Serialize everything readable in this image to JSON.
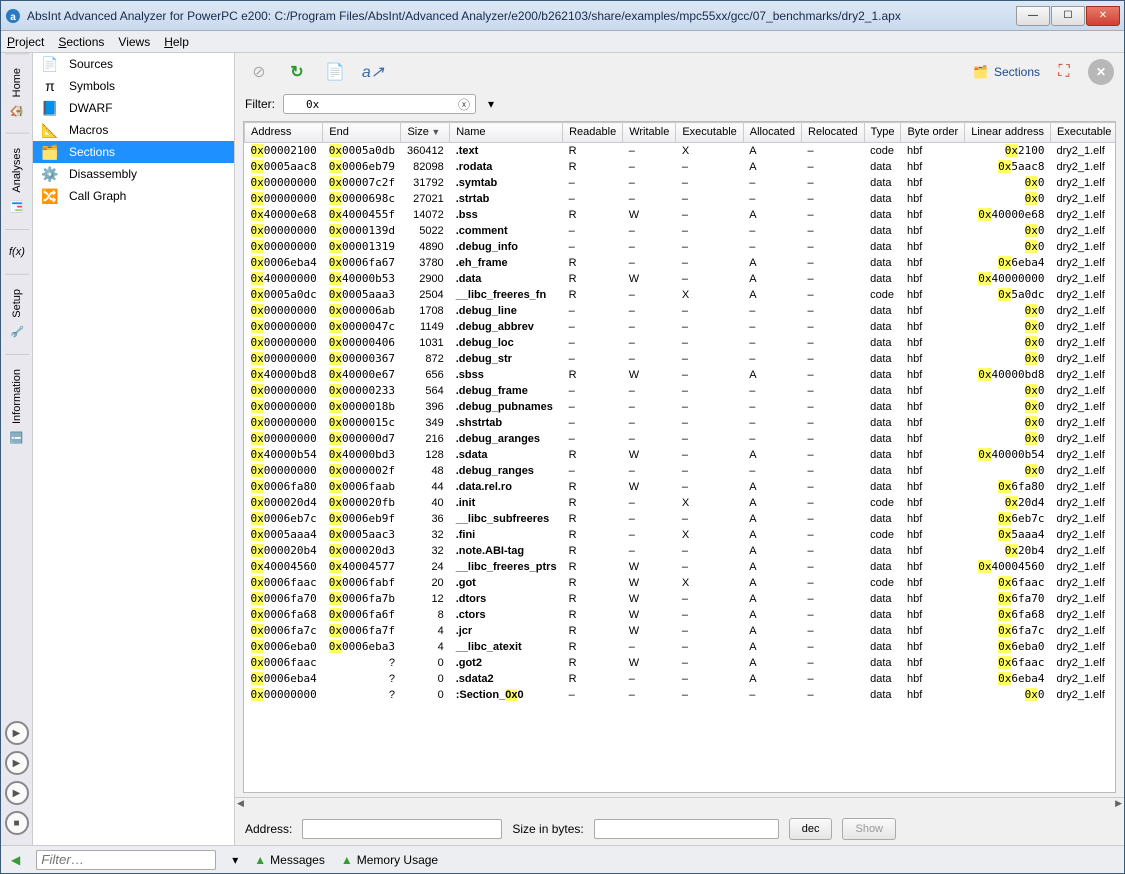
{
  "window": {
    "title": "AbsInt Advanced Analyzer for PowerPC e200: C:/Program Files/AbsInt/Advanced Analyzer/e200/b262103/share/examples/mpc55xx/gcc/07_benchmarks/dry2_1.apx"
  },
  "menu": {
    "project": "Project",
    "sections": "Sections",
    "views": "Views",
    "help": "Help"
  },
  "rail": {
    "home": "Home",
    "analyses": "Analyses",
    "setup": "Setup",
    "information": "Information"
  },
  "sidebar": {
    "items": [
      {
        "label": "Sources"
      },
      {
        "label": "Symbols"
      },
      {
        "label": "DWARF"
      },
      {
        "label": "Macros"
      },
      {
        "label": "Sections"
      },
      {
        "label": "Disassembly"
      },
      {
        "label": "Call Graph"
      }
    ],
    "activeIndex": 4
  },
  "toolbar": {
    "sections_label": "Sections"
  },
  "filter": {
    "label": "Filter:",
    "value": "0x"
  },
  "columns": [
    "Address",
    "End",
    "Size",
    "Name",
    "Readable",
    "Writable",
    "Executable",
    "Allocated",
    "Relocated",
    "Type",
    "Byte order",
    "Linear address",
    "Executable"
  ],
  "sortedColIndex": 2,
  "rows": [
    {
      "addr": "00002100",
      "end": "0005a0db",
      "size": "360412",
      "name": ".text",
      "r": "R",
      "w": "–",
      "x": "X",
      "a": "A",
      "rel": "–",
      "type": "code",
      "bo": "hbf",
      "lin": "2100",
      "exec": "dry2_1.elf"
    },
    {
      "addr": "0005aac8",
      "end": "0006eb79",
      "size": "82098",
      "name": ".rodata",
      "r": "R",
      "w": "–",
      "x": "–",
      "a": "A",
      "rel": "–",
      "type": "data",
      "bo": "hbf",
      "lin": "5aac8",
      "exec": "dry2_1.elf"
    },
    {
      "addr": "00000000",
      "end": "00007c2f",
      "size": "31792",
      "name": ".symtab",
      "r": "–",
      "w": "–",
      "x": "–",
      "a": "–",
      "rel": "–",
      "type": "data",
      "bo": "hbf",
      "lin": "0",
      "exec": "dry2_1.elf"
    },
    {
      "addr": "00000000",
      "end": "0000698c",
      "size": "27021",
      "name": ".strtab",
      "r": "–",
      "w": "–",
      "x": "–",
      "a": "–",
      "rel": "–",
      "type": "data",
      "bo": "hbf",
      "lin": "0",
      "exec": "dry2_1.elf"
    },
    {
      "addr": "40000e68",
      "end": "4000455f",
      "size": "14072",
      "name": ".bss",
      "r": "R",
      "w": "W",
      "x": "–",
      "a": "A",
      "rel": "–",
      "type": "data",
      "bo": "hbf",
      "lin": "40000e68",
      "exec": "dry2_1.elf"
    },
    {
      "addr": "00000000",
      "end": "0000139d",
      "size": "5022",
      "name": ".comment",
      "r": "–",
      "w": "–",
      "x": "–",
      "a": "–",
      "rel": "–",
      "type": "data",
      "bo": "hbf",
      "lin": "0",
      "exec": "dry2_1.elf"
    },
    {
      "addr": "00000000",
      "end": "00001319",
      "size": "4890",
      "name": ".debug_info",
      "r": "–",
      "w": "–",
      "x": "–",
      "a": "–",
      "rel": "–",
      "type": "data",
      "bo": "hbf",
      "lin": "0",
      "exec": "dry2_1.elf"
    },
    {
      "addr": "0006eba4",
      "end": "0006fa67",
      "size": "3780",
      "name": ".eh_frame",
      "r": "R",
      "w": "–",
      "x": "–",
      "a": "A",
      "rel": "–",
      "type": "data",
      "bo": "hbf",
      "lin": "6eba4",
      "exec": "dry2_1.elf"
    },
    {
      "addr": "40000000",
      "end": "40000b53",
      "size": "2900",
      "name": ".data",
      "r": "R",
      "w": "W",
      "x": "–",
      "a": "A",
      "rel": "–",
      "type": "data",
      "bo": "hbf",
      "lin": "40000000",
      "exec": "dry2_1.elf"
    },
    {
      "addr": "0005a0dc",
      "end": "0005aaa3",
      "size": "2504",
      "name": "__libc_freeres_fn",
      "r": "R",
      "w": "–",
      "x": "X",
      "a": "A",
      "rel": "–",
      "type": "code",
      "bo": "hbf",
      "lin": "5a0dc",
      "exec": "dry2_1.elf"
    },
    {
      "addr": "00000000",
      "end": "000006ab",
      "size": "1708",
      "name": ".debug_line",
      "r": "–",
      "w": "–",
      "x": "–",
      "a": "–",
      "rel": "–",
      "type": "data",
      "bo": "hbf",
      "lin": "0",
      "exec": "dry2_1.elf"
    },
    {
      "addr": "00000000",
      "end": "0000047c",
      "size": "1149",
      "name": ".debug_abbrev",
      "r": "–",
      "w": "–",
      "x": "–",
      "a": "–",
      "rel": "–",
      "type": "data",
      "bo": "hbf",
      "lin": "0",
      "exec": "dry2_1.elf"
    },
    {
      "addr": "00000000",
      "end": "00000406",
      "size": "1031",
      "name": ".debug_loc",
      "r": "–",
      "w": "–",
      "x": "–",
      "a": "–",
      "rel": "–",
      "type": "data",
      "bo": "hbf",
      "lin": "0",
      "exec": "dry2_1.elf"
    },
    {
      "addr": "00000000",
      "end": "00000367",
      "size": "872",
      "name": ".debug_str",
      "r": "–",
      "w": "–",
      "x": "–",
      "a": "–",
      "rel": "–",
      "type": "data",
      "bo": "hbf",
      "lin": "0",
      "exec": "dry2_1.elf"
    },
    {
      "addr": "40000bd8",
      "end": "40000e67",
      "size": "656",
      "name": ".sbss",
      "r": "R",
      "w": "W",
      "x": "–",
      "a": "A",
      "rel": "–",
      "type": "data",
      "bo": "hbf",
      "lin": "40000bd8",
      "exec": "dry2_1.elf"
    },
    {
      "addr": "00000000",
      "end": "00000233",
      "size": "564",
      "name": ".debug_frame",
      "r": "–",
      "w": "–",
      "x": "–",
      "a": "–",
      "rel": "–",
      "type": "data",
      "bo": "hbf",
      "lin": "0",
      "exec": "dry2_1.elf"
    },
    {
      "addr": "00000000",
      "end": "0000018b",
      "size": "396",
      "name": ".debug_pubnames",
      "r": "–",
      "w": "–",
      "x": "–",
      "a": "–",
      "rel": "–",
      "type": "data",
      "bo": "hbf",
      "lin": "0",
      "exec": "dry2_1.elf"
    },
    {
      "addr": "00000000",
      "end": "0000015c",
      "size": "349",
      "name": ".shstrtab",
      "r": "–",
      "w": "–",
      "x": "–",
      "a": "–",
      "rel": "–",
      "type": "data",
      "bo": "hbf",
      "lin": "0",
      "exec": "dry2_1.elf"
    },
    {
      "addr": "00000000",
      "end": "000000d7",
      "size": "216",
      "name": ".debug_aranges",
      "r": "–",
      "w": "–",
      "x": "–",
      "a": "–",
      "rel": "–",
      "type": "data",
      "bo": "hbf",
      "lin": "0",
      "exec": "dry2_1.elf"
    },
    {
      "addr": "40000b54",
      "end": "40000bd3",
      "size": "128",
      "name": ".sdata",
      "r": "R",
      "w": "W",
      "x": "–",
      "a": "A",
      "rel": "–",
      "type": "data",
      "bo": "hbf",
      "lin": "40000b54",
      "exec": "dry2_1.elf"
    },
    {
      "addr": "00000000",
      "end": "0000002f",
      "size": "48",
      "name": ".debug_ranges",
      "r": "–",
      "w": "–",
      "x": "–",
      "a": "–",
      "rel": "–",
      "type": "data",
      "bo": "hbf",
      "lin": "0",
      "exec": "dry2_1.elf"
    },
    {
      "addr": "0006fa80",
      "end": "0006faab",
      "size": "44",
      "name": ".data.rel.ro",
      "r": "R",
      "w": "W",
      "x": "–",
      "a": "A",
      "rel": "–",
      "type": "data",
      "bo": "hbf",
      "lin": "6fa80",
      "exec": "dry2_1.elf"
    },
    {
      "addr": "000020d4",
      "end": "000020fb",
      "size": "40",
      "name": ".init",
      "r": "R",
      "w": "–",
      "x": "X",
      "a": "A",
      "rel": "–",
      "type": "code",
      "bo": "hbf",
      "lin": "20d4",
      "exec": "dry2_1.elf"
    },
    {
      "addr": "0006eb7c",
      "end": "0006eb9f",
      "size": "36",
      "name": "__libc_subfreeres",
      "r": "R",
      "w": "–",
      "x": "–",
      "a": "A",
      "rel": "–",
      "type": "data",
      "bo": "hbf",
      "lin": "6eb7c",
      "exec": "dry2_1.elf"
    },
    {
      "addr": "0005aaa4",
      "end": "0005aac3",
      "size": "32",
      "name": ".fini",
      "r": "R",
      "w": "–",
      "x": "X",
      "a": "A",
      "rel": "–",
      "type": "code",
      "bo": "hbf",
      "lin": "5aaa4",
      "exec": "dry2_1.elf"
    },
    {
      "addr": "000020b4",
      "end": "000020d3",
      "size": "32",
      "name": ".note.ABI-tag",
      "r": "R",
      "w": "–",
      "x": "–",
      "a": "A",
      "rel": "–",
      "type": "data",
      "bo": "hbf",
      "lin": "20b4",
      "exec": "dry2_1.elf"
    },
    {
      "addr": "40004560",
      "end": "40004577",
      "size": "24",
      "name": "__libc_freeres_ptrs",
      "r": "R",
      "w": "W",
      "x": "–",
      "a": "A",
      "rel": "–",
      "type": "data",
      "bo": "hbf",
      "lin": "40004560",
      "exec": "dry2_1.elf"
    },
    {
      "addr": "0006faac",
      "end": "0006fabf",
      "size": "20",
      "name": ".got",
      "r": "R",
      "w": "W",
      "x": "X",
      "a": "A",
      "rel": "–",
      "type": "code",
      "bo": "hbf",
      "lin": "6faac",
      "exec": "dry2_1.elf"
    },
    {
      "addr": "0006fa70",
      "end": "0006fa7b",
      "size": "12",
      "name": ".dtors",
      "r": "R",
      "w": "W",
      "x": "–",
      "a": "A",
      "rel": "–",
      "type": "data",
      "bo": "hbf",
      "lin": "6fa70",
      "exec": "dry2_1.elf"
    },
    {
      "addr": "0006fa68",
      "end": "0006fa6f",
      "size": "8",
      "name": ".ctors",
      "r": "R",
      "w": "W",
      "x": "–",
      "a": "A",
      "rel": "–",
      "type": "data",
      "bo": "hbf",
      "lin": "6fa68",
      "exec": "dry2_1.elf"
    },
    {
      "addr": "0006fa7c",
      "end": "0006fa7f",
      "size": "4",
      "name": ".jcr",
      "r": "R",
      "w": "W",
      "x": "–",
      "a": "A",
      "rel": "–",
      "type": "data",
      "bo": "hbf",
      "lin": "6fa7c",
      "exec": "dry2_1.elf"
    },
    {
      "addr": "0006eba0",
      "end": "0006eba3",
      "size": "4",
      "name": "__libc_atexit",
      "r": "R",
      "w": "–",
      "x": "–",
      "a": "A",
      "rel": "–",
      "type": "data",
      "bo": "hbf",
      "lin": "6eba0",
      "exec": "dry2_1.elf"
    },
    {
      "addr": "0006faac",
      "end": "?",
      "size": "0",
      "name": ".got2",
      "r": "R",
      "w": "W",
      "x": "–",
      "a": "A",
      "rel": "–",
      "type": "data",
      "bo": "hbf",
      "lin": "6faac",
      "exec": "dry2_1.elf"
    },
    {
      "addr": "0006eba4",
      "end": "?",
      "size": "0",
      "name": ".sdata2",
      "r": "R",
      "w": "–",
      "x": "–",
      "a": "A",
      "rel": "–",
      "type": "data",
      "bo": "hbf",
      "lin": "6eba4",
      "exec": "dry2_1.elf"
    },
    {
      "addr": "00000000",
      "end": "?",
      "size": "0",
      "name": ":Section_0x0",
      "r": "–",
      "w": "–",
      "x": "–",
      "a": "–",
      "rel": "–",
      "type": "data",
      "bo": "hbf",
      "lin": "0",
      "exec": "dry2_1.elf",
      "nameHl": "0x"
    }
  ],
  "bottom": {
    "address_label": "Address:",
    "size_label": "Size in bytes:",
    "dec": "dec",
    "show": "Show"
  },
  "status": {
    "filter_placeholder": "Filter…",
    "messages": "Messages",
    "memory": "Memory Usage"
  }
}
